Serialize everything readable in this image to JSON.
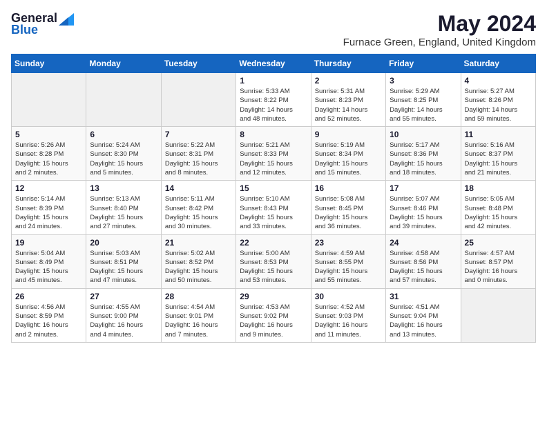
{
  "header": {
    "logo_general": "General",
    "logo_blue": "Blue",
    "month_year": "May 2024",
    "location": "Furnace Green, England, United Kingdom"
  },
  "calendar": {
    "days_of_week": [
      "Sunday",
      "Monday",
      "Tuesday",
      "Wednesday",
      "Thursday",
      "Friday",
      "Saturday"
    ],
    "weeks": [
      [
        {
          "day": "",
          "info": ""
        },
        {
          "day": "",
          "info": ""
        },
        {
          "day": "",
          "info": ""
        },
        {
          "day": "1",
          "info": "Sunrise: 5:33 AM\nSunset: 8:22 PM\nDaylight: 14 hours\nand 48 minutes."
        },
        {
          "day": "2",
          "info": "Sunrise: 5:31 AM\nSunset: 8:23 PM\nDaylight: 14 hours\nand 52 minutes."
        },
        {
          "day": "3",
          "info": "Sunrise: 5:29 AM\nSunset: 8:25 PM\nDaylight: 14 hours\nand 55 minutes."
        },
        {
          "day": "4",
          "info": "Sunrise: 5:27 AM\nSunset: 8:26 PM\nDaylight: 14 hours\nand 59 minutes."
        }
      ],
      [
        {
          "day": "5",
          "info": "Sunrise: 5:26 AM\nSunset: 8:28 PM\nDaylight: 15 hours\nand 2 minutes."
        },
        {
          "day": "6",
          "info": "Sunrise: 5:24 AM\nSunset: 8:30 PM\nDaylight: 15 hours\nand 5 minutes."
        },
        {
          "day": "7",
          "info": "Sunrise: 5:22 AM\nSunset: 8:31 PM\nDaylight: 15 hours\nand 8 minutes."
        },
        {
          "day": "8",
          "info": "Sunrise: 5:21 AM\nSunset: 8:33 PM\nDaylight: 15 hours\nand 12 minutes."
        },
        {
          "day": "9",
          "info": "Sunrise: 5:19 AM\nSunset: 8:34 PM\nDaylight: 15 hours\nand 15 minutes."
        },
        {
          "day": "10",
          "info": "Sunrise: 5:17 AM\nSunset: 8:36 PM\nDaylight: 15 hours\nand 18 minutes."
        },
        {
          "day": "11",
          "info": "Sunrise: 5:16 AM\nSunset: 8:37 PM\nDaylight: 15 hours\nand 21 minutes."
        }
      ],
      [
        {
          "day": "12",
          "info": "Sunrise: 5:14 AM\nSunset: 8:39 PM\nDaylight: 15 hours\nand 24 minutes."
        },
        {
          "day": "13",
          "info": "Sunrise: 5:13 AM\nSunset: 8:40 PM\nDaylight: 15 hours\nand 27 minutes."
        },
        {
          "day": "14",
          "info": "Sunrise: 5:11 AM\nSunset: 8:42 PM\nDaylight: 15 hours\nand 30 minutes."
        },
        {
          "day": "15",
          "info": "Sunrise: 5:10 AM\nSunset: 8:43 PM\nDaylight: 15 hours\nand 33 minutes."
        },
        {
          "day": "16",
          "info": "Sunrise: 5:08 AM\nSunset: 8:45 PM\nDaylight: 15 hours\nand 36 minutes."
        },
        {
          "day": "17",
          "info": "Sunrise: 5:07 AM\nSunset: 8:46 PM\nDaylight: 15 hours\nand 39 minutes."
        },
        {
          "day": "18",
          "info": "Sunrise: 5:05 AM\nSunset: 8:48 PM\nDaylight: 15 hours\nand 42 minutes."
        }
      ],
      [
        {
          "day": "19",
          "info": "Sunrise: 5:04 AM\nSunset: 8:49 PM\nDaylight: 15 hours\nand 45 minutes."
        },
        {
          "day": "20",
          "info": "Sunrise: 5:03 AM\nSunset: 8:51 PM\nDaylight: 15 hours\nand 47 minutes."
        },
        {
          "day": "21",
          "info": "Sunrise: 5:02 AM\nSunset: 8:52 PM\nDaylight: 15 hours\nand 50 minutes."
        },
        {
          "day": "22",
          "info": "Sunrise: 5:00 AM\nSunset: 8:53 PM\nDaylight: 15 hours\nand 53 minutes."
        },
        {
          "day": "23",
          "info": "Sunrise: 4:59 AM\nSunset: 8:55 PM\nDaylight: 15 hours\nand 55 minutes."
        },
        {
          "day": "24",
          "info": "Sunrise: 4:58 AM\nSunset: 8:56 PM\nDaylight: 15 hours\nand 57 minutes."
        },
        {
          "day": "25",
          "info": "Sunrise: 4:57 AM\nSunset: 8:57 PM\nDaylight: 16 hours\nand 0 minutes."
        }
      ],
      [
        {
          "day": "26",
          "info": "Sunrise: 4:56 AM\nSunset: 8:59 PM\nDaylight: 16 hours\nand 2 minutes."
        },
        {
          "day": "27",
          "info": "Sunrise: 4:55 AM\nSunset: 9:00 PM\nDaylight: 16 hours\nand 4 minutes."
        },
        {
          "day": "28",
          "info": "Sunrise: 4:54 AM\nSunset: 9:01 PM\nDaylight: 16 hours\nand 7 minutes."
        },
        {
          "day": "29",
          "info": "Sunrise: 4:53 AM\nSunset: 9:02 PM\nDaylight: 16 hours\nand 9 minutes."
        },
        {
          "day": "30",
          "info": "Sunrise: 4:52 AM\nSunset: 9:03 PM\nDaylight: 16 hours\nand 11 minutes."
        },
        {
          "day": "31",
          "info": "Sunrise: 4:51 AM\nSunset: 9:04 PM\nDaylight: 16 hours\nand 13 minutes."
        },
        {
          "day": "",
          "info": ""
        }
      ]
    ]
  }
}
